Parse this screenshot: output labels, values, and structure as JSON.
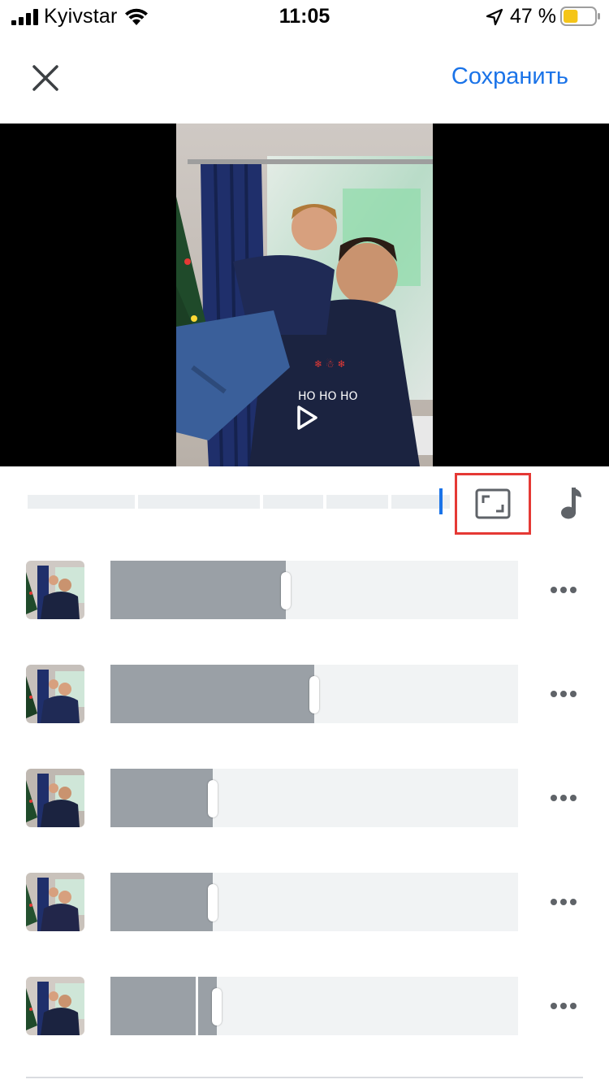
{
  "status_bar": {
    "carrier": "Kyivstar",
    "time": "11:05",
    "battery_percent": "47 %",
    "battery_level": 0.47,
    "battery_color": "#f5c518"
  },
  "header": {
    "close_icon": "close-icon",
    "save_label": "Сохранить",
    "accent_color": "#1a73e8"
  },
  "preview": {
    "play_icon": "play-icon"
  },
  "toolbar": {
    "aspect_icon": "aspect-ratio-icon",
    "music_icon": "music-note-icon",
    "highlight_color": "#e53935"
  },
  "clips": [
    {
      "trim_fraction": 0.43,
      "split_fraction": null
    },
    {
      "trim_fraction": 0.5,
      "split_fraction": null
    },
    {
      "trim_fraction": 0.25,
      "split_fraction": null
    },
    {
      "trim_fraction": 0.25,
      "split_fraction": null
    },
    {
      "trim_fraction": 0.26,
      "split_fraction": 0.21
    }
  ]
}
